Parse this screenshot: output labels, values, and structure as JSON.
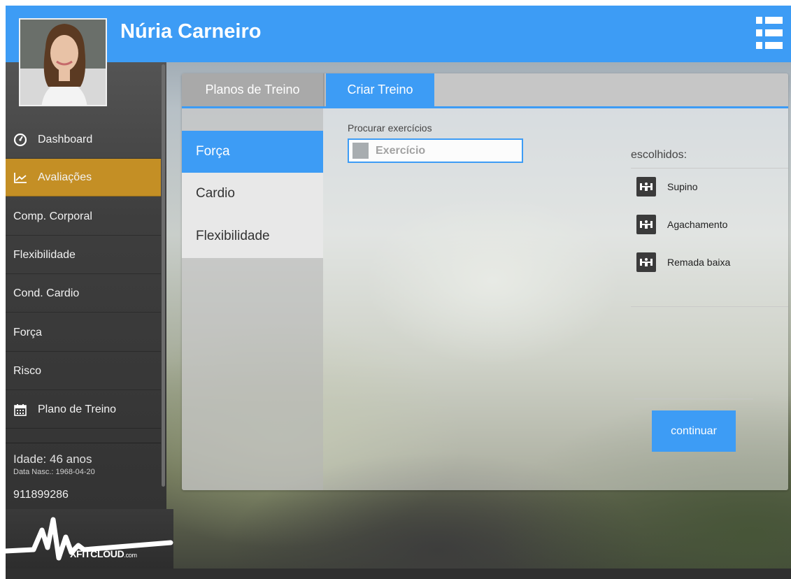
{
  "header": {
    "user_name": "Núria Carneiro",
    "menu_icon": "list-menu-icon"
  },
  "sidebar": {
    "items": [
      {
        "label": "Dashboard",
        "icon": "speedometer-icon"
      },
      {
        "label": "Avaliações",
        "icon": "line-chart-icon"
      },
      {
        "label": "Comp. Corporal"
      },
      {
        "label": "Flexibilidade"
      },
      {
        "label": "Cond. Cardio"
      },
      {
        "label": "Força"
      },
      {
        "label": "Risco"
      },
      {
        "label": "Plano de Treino",
        "icon": "calendar-icon"
      }
    ],
    "active_item": "Avaliações",
    "age": "Idade: 46 anos",
    "birth_date": "Data Nasc.: 1968-04-20",
    "phone": "911899286"
  },
  "logo": {
    "text": "XFITCLOUD",
    "suffix": ".com"
  },
  "tabs": [
    {
      "label": "Planos de Treino"
    },
    {
      "label": "Criar Treino"
    }
  ],
  "active_tab": "Criar Treino",
  "categories": [
    {
      "label": "Força"
    },
    {
      "label": "Cardio"
    },
    {
      "label": "Flexibilidade"
    }
  ],
  "active_category": "Força",
  "search": {
    "label": "Procurar exercícios",
    "placeholder": "Exercício"
  },
  "chosen": {
    "label": "escolhidos:",
    "items": [
      {
        "label": "Supino",
        "icon": "dumbbell-icon"
      },
      {
        "label": "Agachamento",
        "icon": "dumbbell-icon"
      },
      {
        "label": "Remada baixa",
        "icon": "dumbbell-icon"
      }
    ]
  },
  "continue_label": "continuar",
  "colors": {
    "accent": "#3d9cf5",
    "active_sidebar": "#c48f25",
    "sidebar_bg": "#3e3e3e"
  }
}
